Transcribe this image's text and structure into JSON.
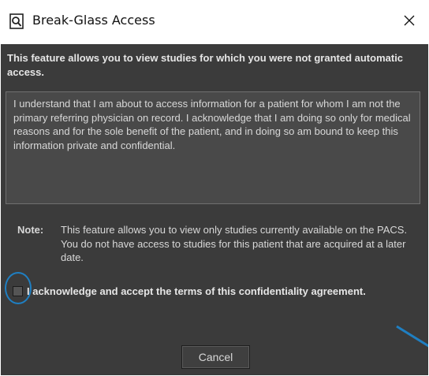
{
  "window": {
    "title": "Break-Glass Access",
    "icon": "magnifier-document-icon",
    "close_glyph": "✕"
  },
  "intro": {
    "text": "This feature allows you to view studies for which you were not granted automatic access."
  },
  "agreement": {
    "text": "I understand that I am about to access information for a patient for whom I am not the primary referring physician on record. I acknowledge that I am doing so only for medical reasons and for the sole benefit of the patient, and in doing so am bound to keep this information private and confidential."
  },
  "note": {
    "label": "Note:",
    "text": "This feature allows you to view only studies currently available on the PACS. You do not have access to studies for this patient that are acquired at a later date."
  },
  "acknowledge": {
    "label": "I acknowledge and accept the terms of this confidentiality agreement.",
    "checked": false
  },
  "buttons": {
    "cancel_label": "Cancel"
  },
  "colors": {
    "dialog_background": "#3b3b3b",
    "text_area_background": "#494949",
    "annotation_blue": "#1f7fc2"
  }
}
